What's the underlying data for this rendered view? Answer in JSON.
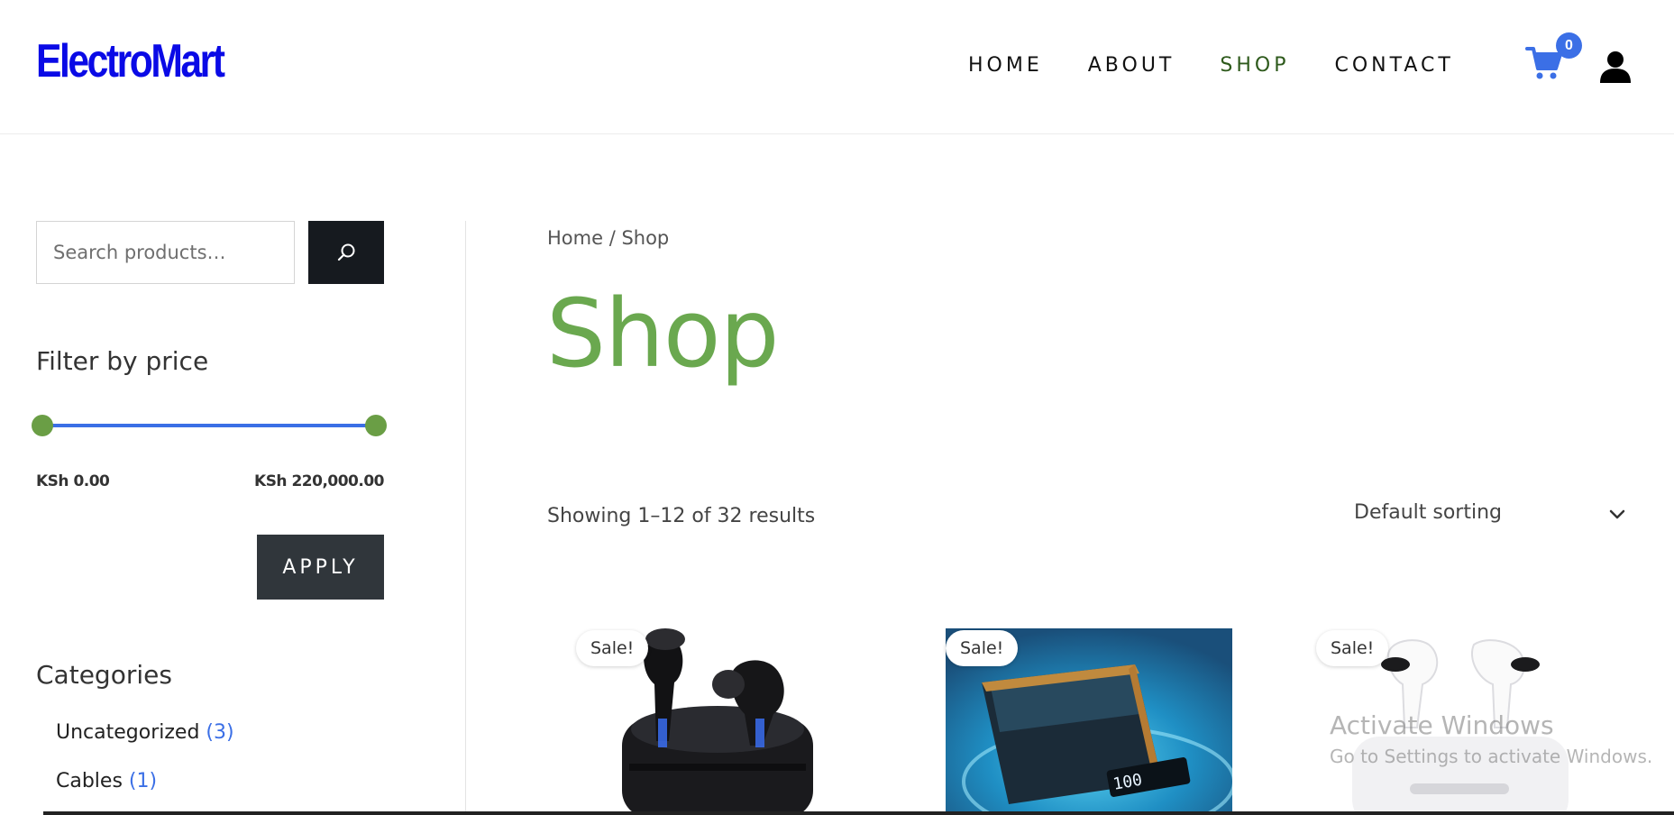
{
  "header": {
    "logo": "ElectroMart",
    "nav": [
      "HOME",
      "ABOUT",
      "SHOP",
      "CONTACT"
    ],
    "active_nav": "SHOP",
    "cart_count": "0",
    "cart_icon": "cart-icon",
    "user_icon": "user-icon"
  },
  "sidebar": {
    "search_placeholder": "Search products…",
    "search_icon": "search-icon",
    "filter_title": "Filter by price",
    "price_min": "KSh 0.00",
    "price_max": "KSh 220,000.00",
    "slider_range": [
      0,
      1
    ],
    "apply_label": "APPLY",
    "categories_title": "Categories",
    "categories": [
      {
        "name": "Uncategorized",
        "count": "(3)"
      },
      {
        "name": "Cables",
        "count": "(1)"
      }
    ]
  },
  "main": {
    "breadcrumb": "Home / Shop",
    "title": "Shop",
    "result_count": "Showing 1–12 of 32 results",
    "sort_selected": "Default sorting",
    "products": [
      {
        "badge": "Sale!"
      },
      {
        "badge": "Sale!"
      },
      {
        "badge": "Sale!"
      }
    ]
  },
  "overlay": {
    "line1": "Activate Windows",
    "line2": "Go to Settings to activate Windows."
  },
  "colors": {
    "logo": "#0a0ae6",
    "accent_green": "#6aa84f",
    "accent_blue": "#3b6fe6",
    "button_dark": "#30363b"
  }
}
